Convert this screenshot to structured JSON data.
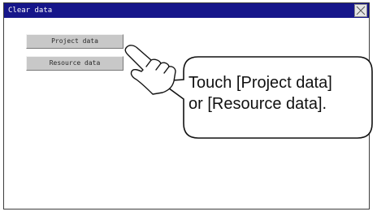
{
  "window": {
    "title": "Clear data"
  },
  "buttons": {
    "project_label": "Project data",
    "resource_label": "Resource data"
  },
  "callout": {
    "line1": "Touch [Project data]",
    "line2": "or [Resource data]."
  },
  "colors": {
    "titlebar": "#16168a",
    "button_face": "#c8c8c8",
    "window_background": "#ffffff"
  },
  "icons": {
    "close": "close-icon",
    "pointer": "pointing-hand-icon"
  }
}
